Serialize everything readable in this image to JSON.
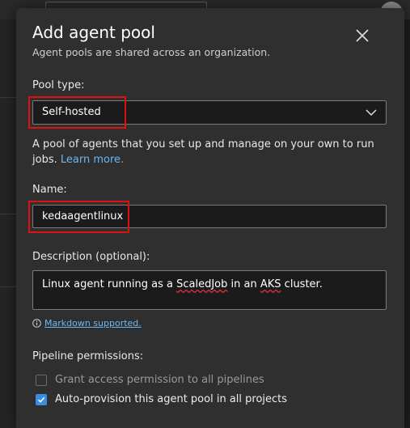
{
  "dialog": {
    "title": "Add agent pool",
    "subtitle": "Agent pools are shared across an organization."
  },
  "pool_type": {
    "label": "Pool type:",
    "value": "Self-hosted",
    "help_text": "A pool of agents that you set up and manage on your own to run jobs.",
    "learn_more": "Learn more."
  },
  "name": {
    "label": "Name:",
    "value": "kedaagentlinux"
  },
  "description": {
    "label": "Description (optional):",
    "text_before": "Linux agent running as a ",
    "text_word1": "ScaledJob",
    "text_middle": " in an ",
    "text_word2": "AKS",
    "text_after": " cluster.",
    "markdown_link": "Markdown supported."
  },
  "pipeline_permissions": {
    "label": "Pipeline permissions:",
    "grant_access": {
      "label": "Grant access permission to all pipelines",
      "checked": false,
      "enabled": false
    },
    "auto_provision": {
      "label": "Auto-provision this agent pool in all projects",
      "checked": true,
      "enabled": true
    }
  },
  "colors": {
    "accent": "#3a8de0",
    "link": "#6cb8f5",
    "highlight": "#e01010"
  },
  "icons": [
    "close-icon",
    "chevron-down-icon",
    "info-icon",
    "checkmark-icon"
  ]
}
